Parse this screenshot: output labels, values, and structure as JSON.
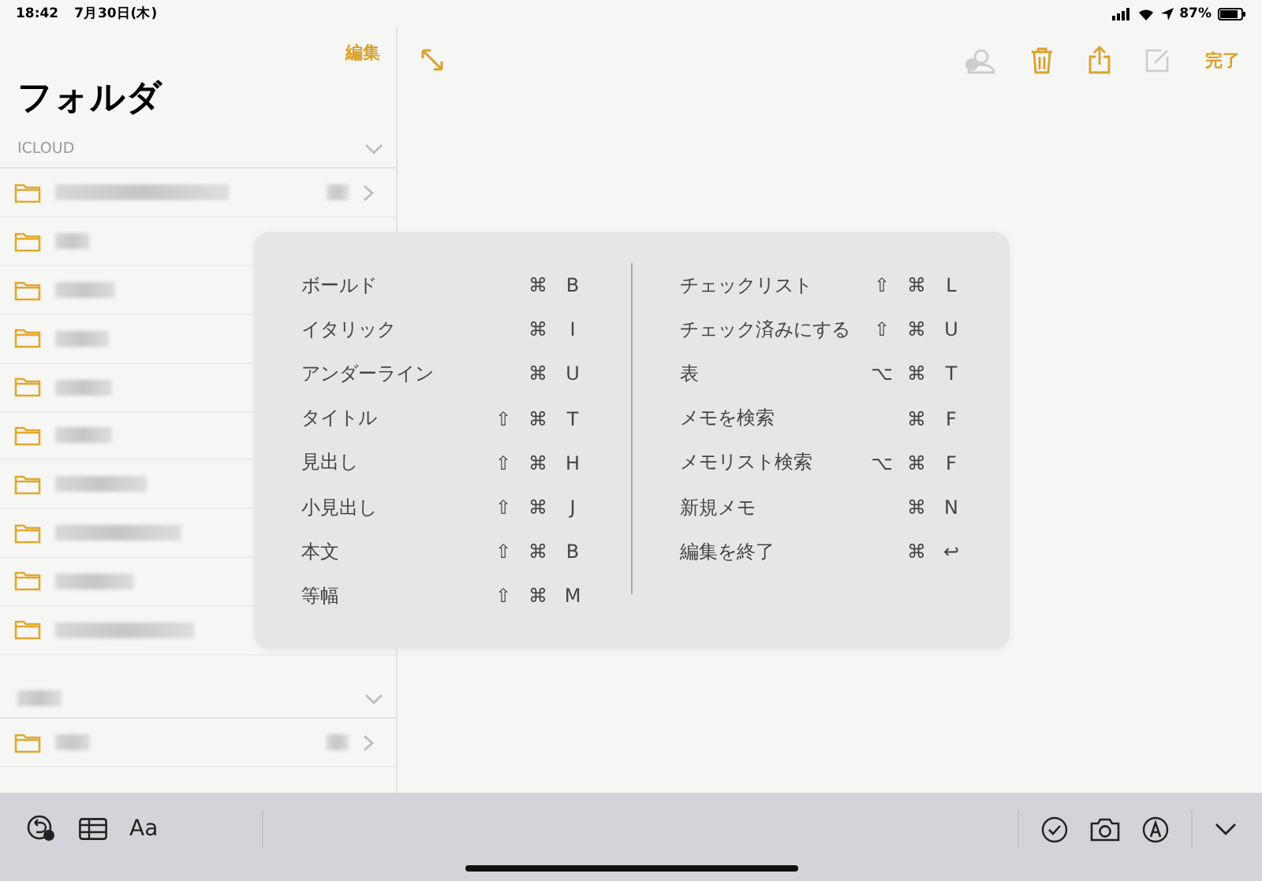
{
  "status_bar": {
    "time": "18:42",
    "date": "7月30日(木)",
    "battery": "87%"
  },
  "sidebar": {
    "edit": "編集",
    "title": "フォルダ",
    "sections": [
      {
        "title": "ICLOUD",
        "folders": [
          {
            "chevron": true
          }
        ]
      },
      {
        "folders": [
          {
            "chevron": true
          }
        ]
      }
    ]
  },
  "toolbar": {
    "done": "完了"
  },
  "shortcuts": {
    "columns": [
      [
        {
          "label": "ボールド",
          "keys": [
            "⌘",
            "B"
          ]
        },
        {
          "label": "イタリック",
          "keys": [
            "⌘",
            "I"
          ]
        },
        {
          "label": "アンダーライン",
          "keys": [
            "⌘",
            "U"
          ]
        },
        {
          "label": "タイトル",
          "keys": [
            "⇧",
            "⌘",
            "T"
          ]
        },
        {
          "label": "見出し",
          "keys": [
            "⇧",
            "⌘",
            "H"
          ]
        },
        {
          "label": "小見出し",
          "keys": [
            "⇧",
            "⌘",
            "J"
          ]
        },
        {
          "label": "本文",
          "keys": [
            "⇧",
            "⌘",
            "B"
          ]
        },
        {
          "label": "等幅",
          "keys": [
            "⇧",
            "⌘",
            "M"
          ]
        }
      ],
      [
        {
          "label": "チェックリスト",
          "keys": [
            "⇧",
            "⌘",
            "L"
          ]
        },
        {
          "label": "チェック済みにする",
          "keys": [
            "⇧",
            "⌘",
            "U"
          ]
        },
        {
          "label": "表",
          "keys": [
            "⌥",
            "⌘",
            "T"
          ]
        },
        {
          "label": "メモを検索",
          "keys": [
            "⌘",
            "F"
          ]
        },
        {
          "label": "メモリスト検索",
          "keys": [
            "⌥",
            "⌘",
            "F"
          ]
        },
        {
          "label": "新規メモ",
          "keys": [
            "⌘",
            "N"
          ]
        },
        {
          "label": "編集を終了",
          "keys": [
            "⌘",
            "↩"
          ]
        }
      ]
    ]
  },
  "bottom_bar": {
    "format": "Aa"
  }
}
